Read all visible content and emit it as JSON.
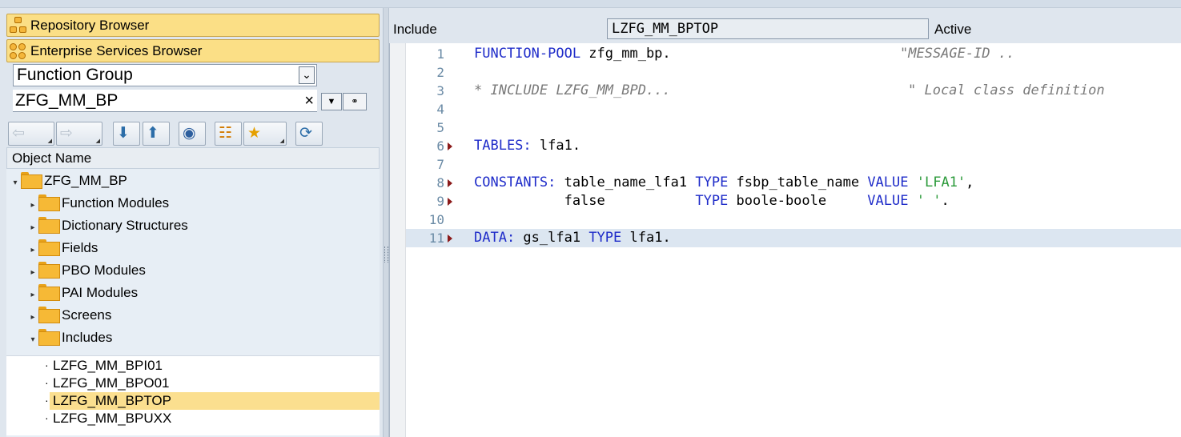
{
  "nav": {
    "repository_browser": "Repository Browser",
    "enterprise_services_browser": "Enterprise Services Browser",
    "object_type": "Function Group",
    "object_name_value": "ZFG_MM_BP",
    "clear_symbol": "×"
  },
  "tree": {
    "header": "Object Name",
    "root": "ZFG_MM_BP",
    "folders": [
      "Function Modules",
      "Dictionary Structures",
      "Fields",
      "PBO Modules",
      "PAI Modules",
      "Screens",
      "Includes"
    ],
    "includes": [
      "LZFG_MM_BPI01",
      "LZFG_MM_BPO01",
      "LZFG_MM_BPTOP",
      "LZFG_MM_BPUXX"
    ],
    "selected_include": "LZFG_MM_BPTOP"
  },
  "editor": {
    "label": "Include",
    "include_name": "LZFG_MM_BPTOP",
    "status": "Active",
    "line_numbers": [
      "1",
      "2",
      "3",
      "4",
      "5",
      "6",
      "7",
      "8",
      "9",
      "10",
      "11"
    ],
    "lines": {
      "l1_kw": "FUNCTION-POOL",
      "l1_rest": " zfg_mm_bp.",
      "l1_comment": "\"MESSAGE-ID ..",
      "l3_comment": "* INCLUDE LZFG_MM_BPD...",
      "l3_comment2": "\" Local class definition",
      "l6_kw": "TABLES:",
      "l6_rest": " lfa1.",
      "l8_kw": "CONSTANTS:",
      "l8_a": " table_name_lfa1 ",
      "l8_type": "TYPE",
      "l8_b": " fsbp_table_name ",
      "l8_value": "VALUE",
      "l8_str": "'LFA1'",
      "l8_end": ",",
      "l9_a": "           false           ",
      "l9_type": "TYPE",
      "l9_b": " boole-boole     ",
      "l9_value": "VALUE",
      "l9_str": "' '",
      "l9_end": ".",
      "l11_kw": "DATA:",
      "l11_a": " gs_lfa1 ",
      "l11_type": "TYPE",
      "l11_b": " lfa1."
    }
  },
  "colors": {
    "keyword": "#1f2cc9",
    "comment": "#7a7a7a",
    "string": "#2b9a3a",
    "selection": "#fbdf8f",
    "highlight_line": "#dce6f1"
  },
  "icons": [
    "hierarchy-icon",
    "services-icon",
    "chevron-down-icon",
    "back-icon",
    "forward-icon",
    "expand-all-icon",
    "collapse-all-icon",
    "binoculars-icon",
    "hierarchy-add-icon",
    "favorites-star-icon",
    "refresh-icon",
    "folder-icon",
    "breakpoint-marker-icon"
  ]
}
